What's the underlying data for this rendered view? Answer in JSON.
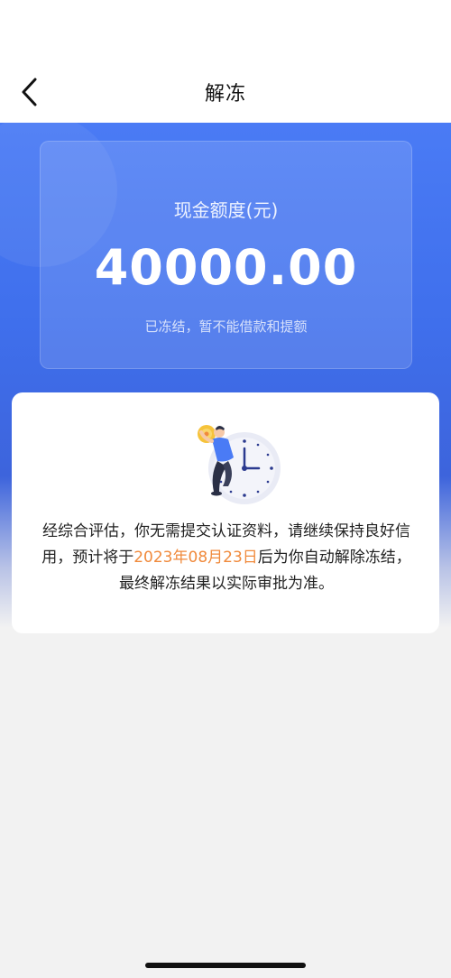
{
  "nav": {
    "title": "解冻",
    "back_icon": "chevron-left-icon"
  },
  "quota_card": {
    "label": "现金额度(元)",
    "amount": "40000.00",
    "status": "已冻结，暂不能借款和提额"
  },
  "info": {
    "illustration_icon": "person-with-clock-illustration",
    "text_before": "经综合评估，你无需提交认证资料，请继续保持良好信用，预计将于",
    "date": "2023年08月23日",
    "text_after": "后为你自动解除冻结，最终解冻结果以实际审批为准。"
  },
  "colors": {
    "primary_blue": "#4a7bf5",
    "date_orange": "#f08a3c",
    "background": "#f2f2f2"
  }
}
